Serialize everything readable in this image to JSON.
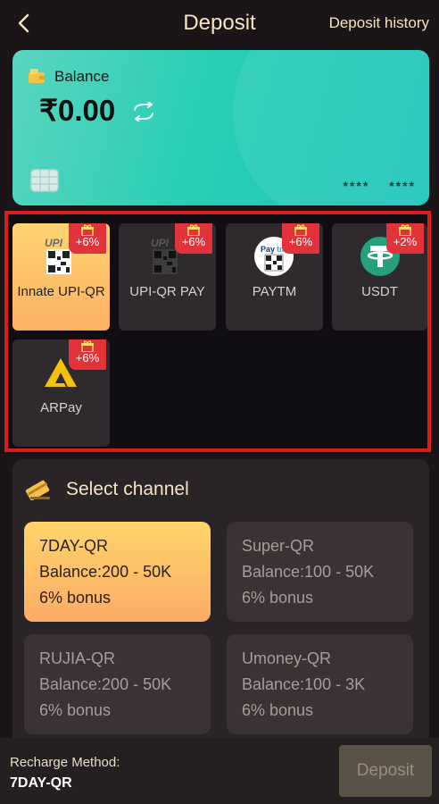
{
  "header": {
    "title": "Deposit",
    "history_link": "Deposit history"
  },
  "balance_card": {
    "label": "Balance",
    "amount": "₹0.00",
    "card_number": "**** ****"
  },
  "methods": [
    {
      "label": "Innate UPI-QR",
      "bonus": "+6%",
      "active": true,
      "icon": "upi-qr-icon"
    },
    {
      "label": "UPI-QR PAY",
      "bonus": "+6%",
      "active": false,
      "icon": "upi-qr-icon"
    },
    {
      "label": "PAYTM",
      "bonus": "+6%",
      "active": false,
      "icon": "paytm-icon"
    },
    {
      "label": "USDT",
      "bonus": "+2%",
      "active": false,
      "icon": "tether-icon"
    },
    {
      "label": "ARPay",
      "bonus": "+6%",
      "active": false,
      "icon": "arpay-icon"
    }
  ],
  "channel_section": {
    "title": "Select channel",
    "channels": [
      {
        "name": "7DAY-QR",
        "balance": "Balance:200 - 50K",
        "bonus": "6% bonus",
        "active": true
      },
      {
        "name": "Super-QR",
        "balance": "Balance:100 - 50K",
        "bonus": "6% bonus",
        "active": false
      },
      {
        "name": "RUJIA-QR",
        "balance": "Balance:200 - 50K",
        "bonus": "6% bonus",
        "active": false
      },
      {
        "name": "Umoney-QR",
        "balance": "Balance:100 - 3K",
        "bonus": "6% bonus",
        "active": false
      }
    ]
  },
  "footer": {
    "method_label": "Recharge Method:",
    "method_value": "7DAY-QR",
    "deposit_label": "Deposit"
  },
  "colors": {
    "accent_gold": "#ffd470",
    "badge_red": "#e2333b",
    "card_teal": "#28cfb4",
    "highlight_border": "#e01b1b"
  }
}
